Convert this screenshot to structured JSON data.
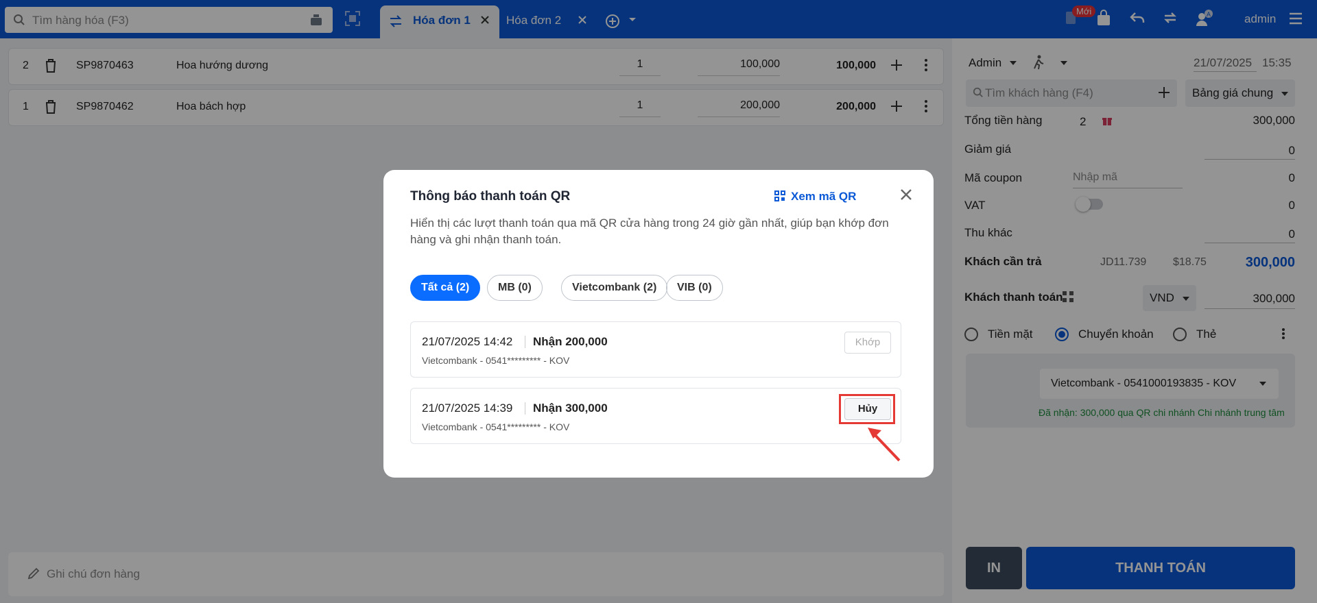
{
  "search": {
    "placeholder": "Tìm hàng hóa (F3)"
  },
  "tabs": [
    {
      "label": "Hóa đơn 1"
    },
    {
      "label": "Hóa đơn 2"
    }
  ],
  "header": {
    "new_badge": "Mới",
    "admin_label": "admin",
    "avatar_letter": "A"
  },
  "cart": {
    "rows": [
      {
        "index": "2",
        "code": "SP9870463",
        "name": "Hoa hướng dương",
        "qty": "1",
        "price": "100,000",
        "total": "100,000"
      },
      {
        "index": "1",
        "code": "SP9870462",
        "name": "Hoa bách hợp",
        "qty": "1",
        "price": "200,000",
        "total": "200,000"
      }
    ],
    "note_placeholder": "Ghi chú đơn hàng"
  },
  "panel": {
    "user": "Admin",
    "date": "21/07/2025",
    "time": "15:35",
    "customer_placeholder": "Tìm khách hàng (F4)",
    "price_list": "Bảng giá chung",
    "total_label": "Tổng tiền hàng",
    "total_count": "2",
    "total_value": "300,000",
    "discount_label": "Giảm giá",
    "discount_value": "0",
    "coupon_label": "Mã coupon",
    "coupon_placeholder": "Nhập mã",
    "coupon_value": "0",
    "vat_label": "VAT",
    "vat_value": "0",
    "other_label": "Thu khác",
    "other_value": "0",
    "due_label": "Khách cần trả",
    "due_jd": "JD11.739",
    "due_usd": "$18.75",
    "due_value": "300,000",
    "paid_label": "Khách thanh toán",
    "currency": "VND",
    "paid_value": "300,000",
    "methods": [
      "Tiền mặt",
      "Chuyển khoản",
      "Thẻ"
    ],
    "bank_account": "Vietcombank - 0541000193835 - KOV",
    "bank_note": "Đã nhận: 300,000 qua QR chi nhánh Chi nhánh trung tâm",
    "print_label": "IN",
    "pay_label": "THANH TOÁN"
  },
  "modal": {
    "title": "Thông báo thanh toán QR",
    "view_qr": "Xem mã QR",
    "description": "Hiển thị các lượt thanh toán qua mã QR cửa hàng trong 24 giờ gần nhất, giúp bạn khớp đơn hàng và ghi nhận thanh toán.",
    "filters": [
      "Tất cả (2)",
      "MB (0)",
      "Vietcombank (2)",
      "VIB (0)"
    ],
    "transactions": [
      {
        "time": "21/07/2025 14:42",
        "amount": "Nhận 200,000",
        "account": "Vietcombank - 0541********* - KOV",
        "action": "Khớp"
      },
      {
        "time": "21/07/2025 14:39",
        "amount": "Nhận 300,000",
        "account": "Vietcombank - 0541********* - KOV",
        "action": "Hủy"
      }
    ]
  },
  "colors": {
    "brand": "#0b59d6",
    "active_chip": "#0b6dff",
    "highlight": "#e53935",
    "success": "#1a8a3a"
  }
}
